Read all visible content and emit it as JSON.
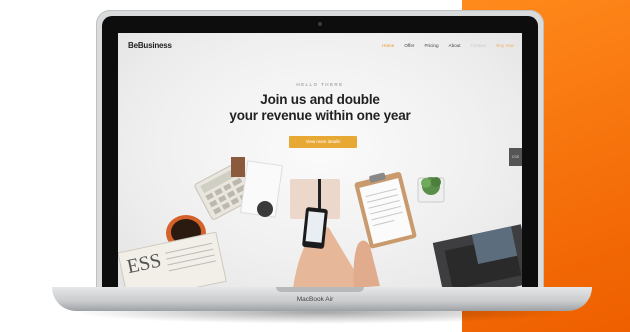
{
  "site": {
    "logo": "BeBusiness",
    "nav": [
      {
        "label": "Home",
        "state": "active"
      },
      {
        "label": "Offer",
        "state": "normal"
      },
      {
        "label": "Pricing",
        "state": "normal"
      },
      {
        "label": "About",
        "state": "normal"
      },
      {
        "label": "Contact",
        "state": "faded"
      },
      {
        "label": "Buy now",
        "state": "cta"
      }
    ],
    "hero": {
      "eyebrow": "HELLO THERE",
      "headline_line1": "Join us and double",
      "headline_line2": "your revenue within one year",
      "button": "View more details"
    },
    "side_tab": "CSS"
  },
  "device": {
    "label": "MacBook Air"
  },
  "colors": {
    "accent": "#e8a834",
    "background_band": "#f36a06",
    "headline": "#222222"
  },
  "icons": [
    "camera-icon"
  ]
}
